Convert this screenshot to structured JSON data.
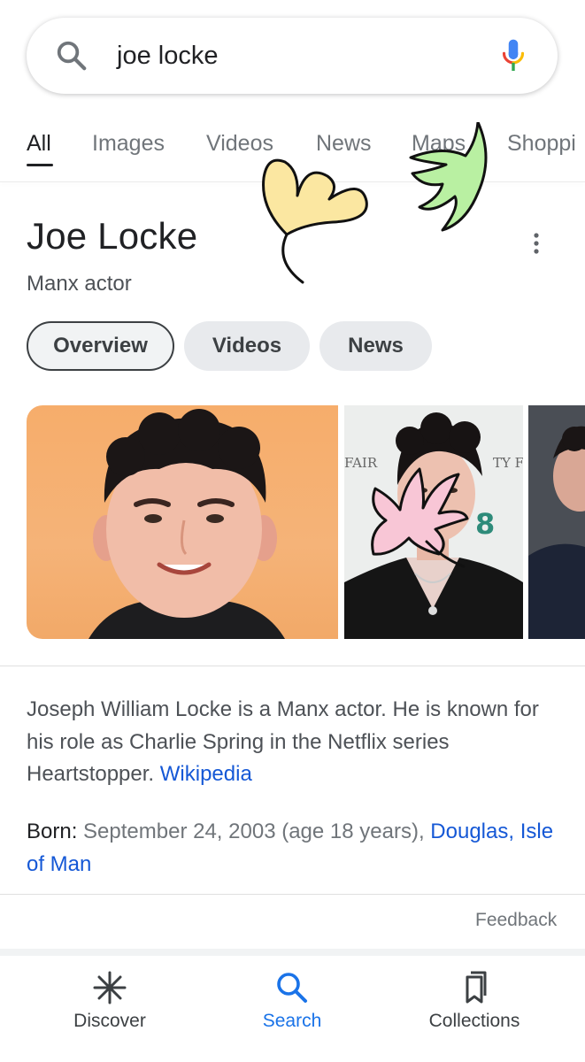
{
  "search": {
    "query": "joe locke"
  },
  "tabs": [
    {
      "label": "All",
      "active": true
    },
    {
      "label": "Images"
    },
    {
      "label": "Videos"
    },
    {
      "label": "News"
    },
    {
      "label": "Maps"
    },
    {
      "label": "Shoppi"
    }
  ],
  "knowledge_panel": {
    "title": "Joe Locke",
    "subtitle": "Manx actor",
    "chips": [
      "Overview",
      "Videos",
      "News"
    ],
    "image_captions": {
      "photo2_backdrop_text_left": "FAIR",
      "photo2_backdrop_text_right": "TY F",
      "photo2_backdrop_digit": "8"
    },
    "description": "Joseph William Locke is a Manx actor. He is known for his role as Charlie Spring in the Netflix series Heartstopper.",
    "description_link": "Wikipedia",
    "born_label": "Born:",
    "born_value": "September 24, 2003 (age 18 years),",
    "born_place_1": "Douglas,",
    "born_place_2": "Isle of Man",
    "feedback": "Feedback"
  },
  "bottom_nav": [
    {
      "label": "Discover",
      "icon": "asterisk-icon"
    },
    {
      "label": "Search",
      "icon": "search-icon",
      "active": true
    },
    {
      "label": "Collections",
      "icon": "bookmarks-icon"
    }
  ],
  "colors": {
    "link": "#1558d6",
    "active_nav": "#1a73e8",
    "doodle_yellow": "#fbe7a1",
    "doodle_green": "#b9f0a2",
    "doodle_pink": "#f8c6d6"
  }
}
